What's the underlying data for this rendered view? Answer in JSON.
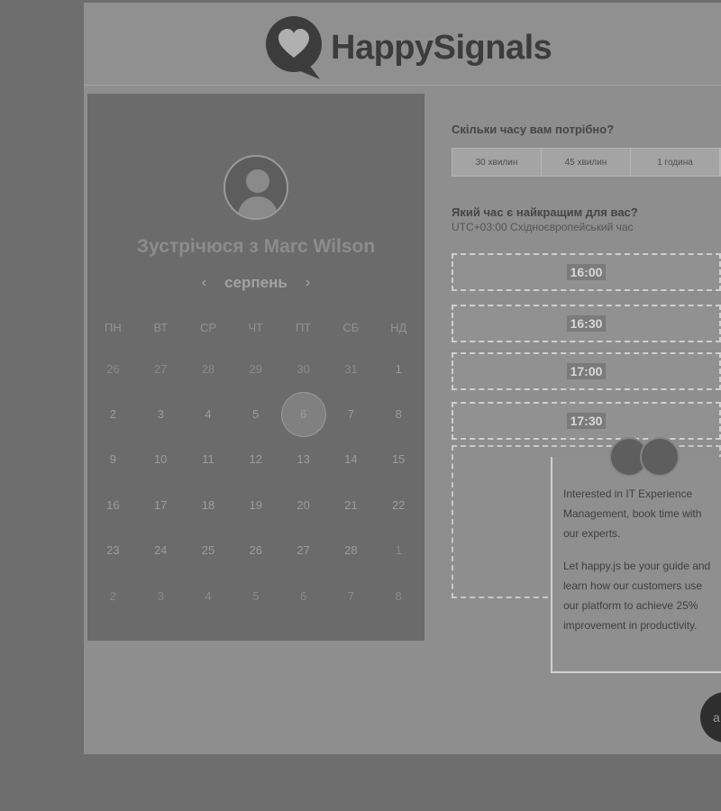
{
  "brand": {
    "name": "HappySignals",
    "icon": "heart-speech-bubble-icon"
  },
  "calendar": {
    "title": "Зустрічюся з Marc Wilson",
    "month": "серпень",
    "weekdays": [
      "ПН",
      "ВТ",
      "СР",
      "ЧТ",
      "ПТ",
      "СБ",
      "НД"
    ],
    "weeks": [
      [
        "26",
        "27",
        "28",
        "29",
        "30",
        "31",
        "1"
      ],
      [
        "2",
        "3",
        "4",
        "5",
        "6",
        "7",
        "8"
      ],
      [
        "9",
        "10",
        "11",
        "12",
        "13",
        "14",
        "15"
      ],
      [
        "16",
        "17",
        "18",
        "19",
        "20",
        "21",
        "22"
      ],
      [
        "23",
        "24",
        "25",
        "26",
        "27",
        "28",
        "1"
      ],
      [
        "2",
        "3",
        "4",
        "5",
        "6",
        "7",
        "8"
      ]
    ],
    "selected_day": "6"
  },
  "duration": {
    "label": "Скільки часу вам потрібно?",
    "options": [
      "30 хвилин",
      "45 хвилин",
      "1 година"
    ]
  },
  "time": {
    "label": "Який час є найкращим для вас?",
    "timezone": "UTC+03:00 Східноєвропейський час",
    "slots": [
      "16:00",
      "16:30",
      "17:00",
      "17:30"
    ]
  },
  "tooltip": {
    "paragraph1": "Interested in IT Experience Management, book time with our experts.",
    "paragraph2": "Let happy.js be your guide and learn how our customers use our platform to achieve 25% improvement in productivity."
  },
  "chat": {
    "label": "a"
  },
  "colors": {
    "panel": "#6b6b6b",
    "brand_text": "#3c3c3c"
  }
}
